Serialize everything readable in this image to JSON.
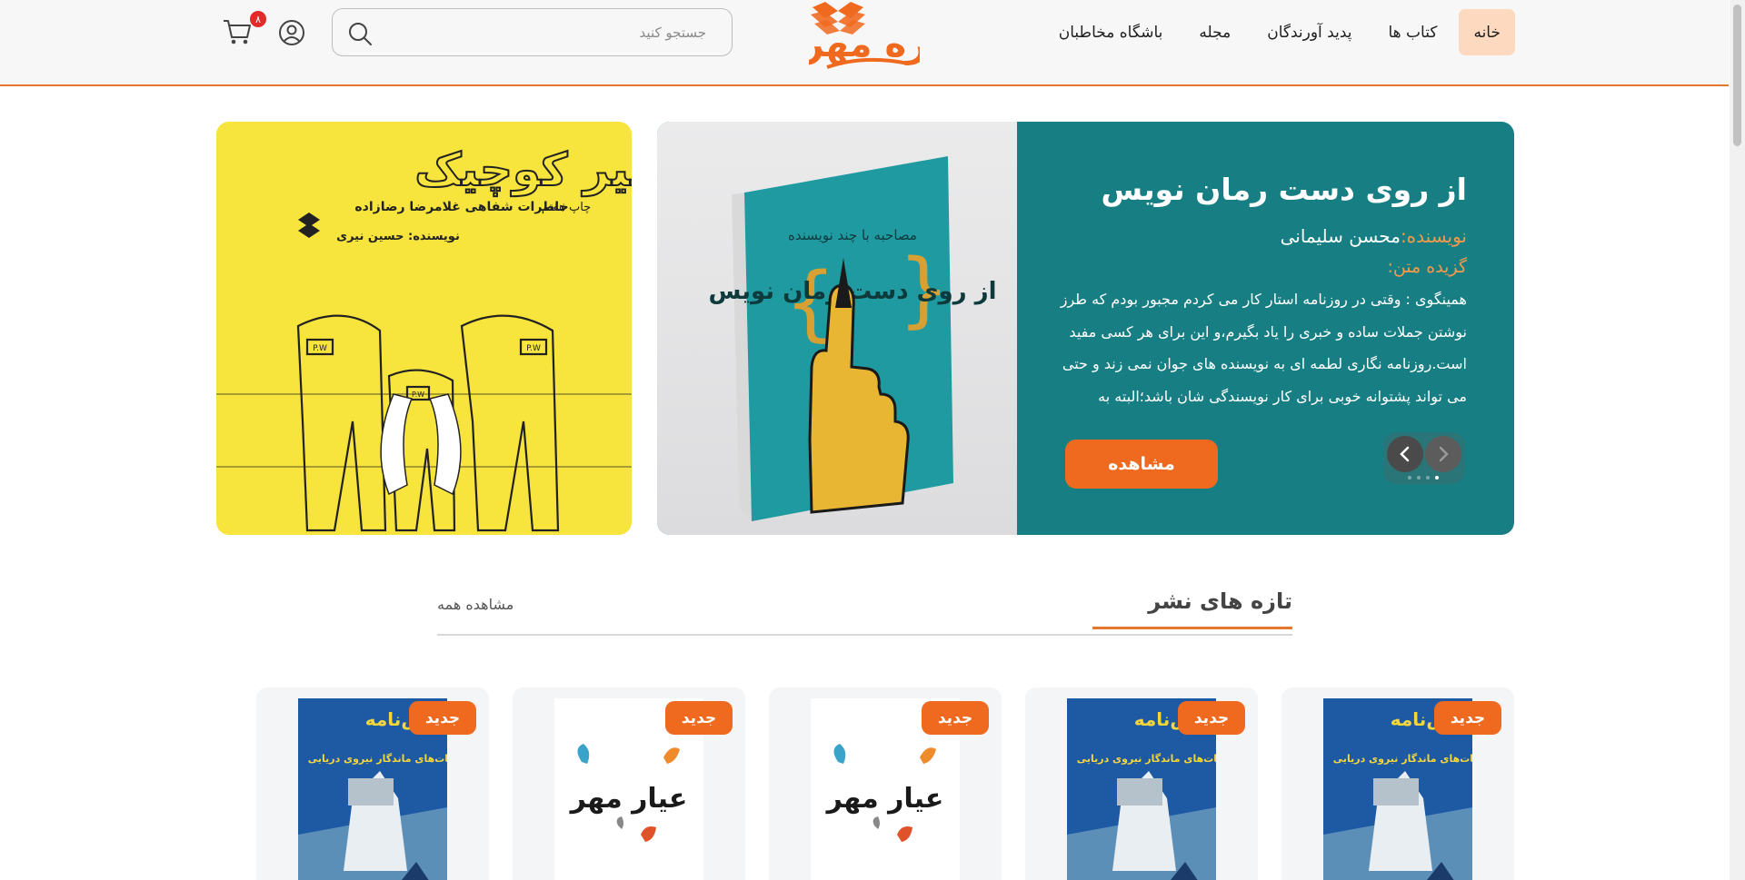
{
  "header": {
    "nav": [
      {
        "label": "خانه",
        "active": true
      },
      {
        "label": "کتاب ها",
        "active": false
      },
      {
        "label": "پدید آورندگان",
        "active": false
      },
      {
        "label": "مجله",
        "active": false
      },
      {
        "label": "باشگاه مخاطبان",
        "active": false
      }
    ],
    "logo_text": "سوره مهر",
    "search": {
      "placeholder": "جستجو کنید",
      "value": ""
    },
    "cart_count": "۸"
  },
  "hero": {
    "title": "از روی دست رمان نویس",
    "author_label": "نویسنده:",
    "author": "محسن سلیمانی",
    "excerpt_label": "گزیده متن:",
    "excerpt": "همینگوی : وقتی در روزنامه استار کار می کردم مجبور بودم که طرز نوشتن جملات ساده و خبری را یاد بگیرم،و این برای هر کسی مفید است.روزنامه نگاری لطمه ای به نویسنده های جوان نمی زند و حتی می تواند پشتوانه خوبی برای کار نویسندگی شان باشد؛البته به",
    "button": "مشاهده",
    "book_cover_text": "از روی دست رمان نویس",
    "book_cover_top": "مصاحبه با چند نویسنده",
    "slides": 4,
    "active_slide": 4
  },
  "side_banner": {
    "title": "اسیر کوچیک",
    "subtitle": "خاطرات شفاهی غلامرضا رضازاده",
    "edition": "چاپ هفتم",
    "author": "نویسنده: حسین نیری",
    "pw": "P.W"
  },
  "section": {
    "title": "تازه های نشر",
    "view_all": "مشاهده همه"
  },
  "cards": [
    {
      "badge": "جدید",
      "cover": "navy",
      "cover_title": "دانش‌نامه",
      "cover_sub": "عملیات‌های ماندگار نیروی دریایی"
    },
    {
      "badge": "جدید",
      "cover": "navy",
      "cover_title": "دانش‌نامه",
      "cover_sub": "عملیات‌های ماندگار نیروی دریایی"
    },
    {
      "badge": "جدید",
      "cover": "butterfly",
      "cover_title": "عیار مهر"
    },
    {
      "badge": "جدید",
      "cover": "butterfly",
      "cover_title": "عیار مهر"
    },
    {
      "badge": "جدید",
      "cover": "navy",
      "cover_title": "دانش‌نامه",
      "cover_sub": "عملیات‌های ماندگار نیروی دریایی"
    }
  ],
  "colors": {
    "accent": "#ef6a1f",
    "teal": "#177f84",
    "active_nav": "#fcd9bf"
  }
}
